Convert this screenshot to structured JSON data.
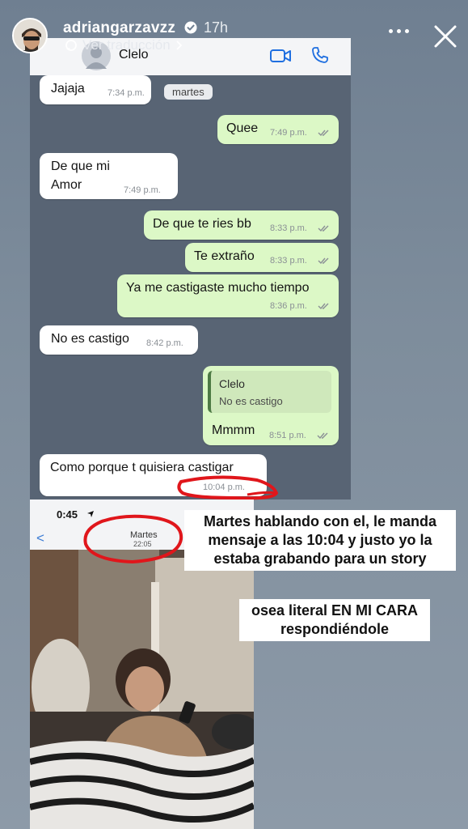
{
  "story": {
    "username": "adriangarzavzz",
    "time": "17h",
    "translate_label": "Ver traducción"
  },
  "chat": {
    "contact_name": "Clelo",
    "day_separator": "martes",
    "messages": [
      {
        "dir": "in",
        "text": "Jajaja",
        "time": "7:34 p.m."
      },
      {
        "dir": "out",
        "text": "Quee",
        "time": "7:49 p.m."
      },
      {
        "dir": "in",
        "text_line1": "De que mi",
        "text_line2": "Amor",
        "time": "7:49 p.m."
      },
      {
        "dir": "out",
        "text": "De que te ries bb",
        "time": "8:33 p.m."
      },
      {
        "dir": "out",
        "text": "Te extraño",
        "time": "8:33 p.m."
      },
      {
        "dir": "out",
        "text": "Ya me castigaste mucho tiempo",
        "time": "8:36 p.m."
      },
      {
        "dir": "in",
        "text": "No es castigo",
        "time": "8:42 p.m."
      },
      {
        "dir": "out",
        "quote_name": "Clelo",
        "quote_text": "No es castigo",
        "text": "Mmmm",
        "time": "8:51 p.m."
      },
      {
        "dir": "in",
        "text": "Como porque t quisiera castigar",
        "time": "10:04 p.m."
      }
    ]
  },
  "video_screen": {
    "clock": "0:45",
    "back": "<",
    "day": "Martes",
    "time": "22:05"
  },
  "captions": {
    "first": [
      "Martes hablando con el, le manda",
      "mensaje a las 10:04 y justo yo la",
      "estaba grabando para un story"
    ],
    "second": [
      "osea literal EN MI CARA",
      "respondiéndole"
    ]
  },
  "colors": {
    "chat_bg": "#586474",
    "out_bubble": "#dcf8c6",
    "in_bubble": "#ffffff",
    "annotation_red": "#e0161b",
    "wa_icon": "#1f6fe0"
  },
  "icons": [
    "verified-icon",
    "translate-icon",
    "chevron-right-icon",
    "more-icon",
    "close-icon",
    "video-call-icon",
    "phone-icon",
    "double-check-icon",
    "location-arrow-icon"
  ]
}
